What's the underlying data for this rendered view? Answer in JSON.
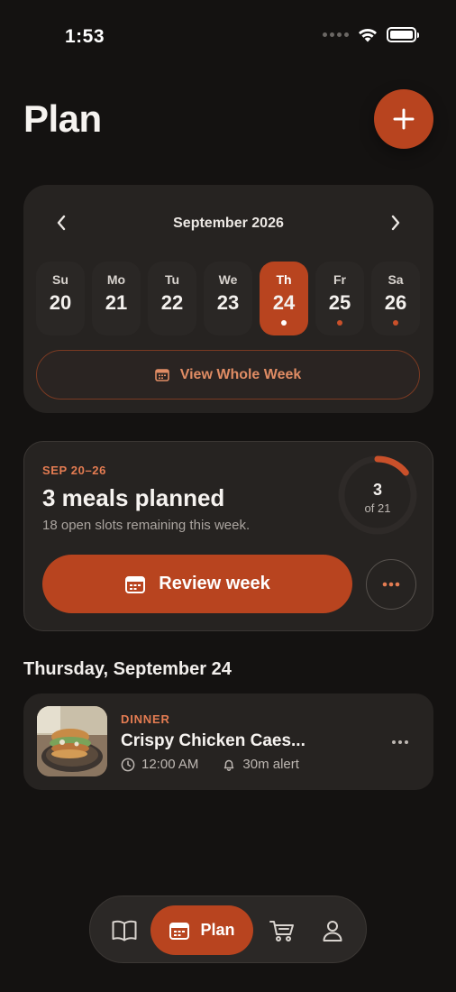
{
  "status_bar": {
    "time": "1:53"
  },
  "header": {
    "title": "Plan",
    "add_icon": "plus-icon"
  },
  "calendar": {
    "month_label": "September 2026",
    "days": [
      {
        "dow": "Su",
        "num": "20",
        "has_meal": false,
        "selected": false
      },
      {
        "dow": "Mo",
        "num": "21",
        "has_meal": false,
        "selected": false
      },
      {
        "dow": "Tu",
        "num": "22",
        "has_meal": false,
        "selected": false
      },
      {
        "dow": "We",
        "num": "23",
        "has_meal": false,
        "selected": false
      },
      {
        "dow": "Th",
        "num": "24",
        "has_meal": true,
        "selected": true
      },
      {
        "dow": "Fr",
        "num": "25",
        "has_meal": true,
        "selected": false
      },
      {
        "dow": "Sa",
        "num": "26",
        "has_meal": true,
        "selected": false
      }
    ],
    "view_week_label": "View Whole Week"
  },
  "summary": {
    "range": "SEP 20–26",
    "title": "3 meals planned",
    "subtitle": "18 open slots remaining this week.",
    "progress_count": "3",
    "progress_total_label": "of 21",
    "progress_fraction": 0.142857,
    "review_label": "Review week"
  },
  "day_section": {
    "heading": "Thursday, September 24",
    "meals": [
      {
        "type": "DINNER",
        "name": "Crispy Chicken Caes...",
        "time": "12:00 AM",
        "alert": "30m alert"
      }
    ]
  },
  "nav": {
    "items": [
      {
        "id": "recipes",
        "icon": "book-icon",
        "label": ""
      },
      {
        "id": "plan",
        "icon": "calendar-icon",
        "label": "Plan",
        "active": true
      },
      {
        "id": "cart",
        "icon": "cart-icon",
        "label": ""
      },
      {
        "id": "profile",
        "icon": "person-icon",
        "label": ""
      }
    ]
  },
  "colors": {
    "accent": "#b8441f",
    "accent_text": "#e47c52",
    "background": "#141211",
    "card": "#262321"
  }
}
